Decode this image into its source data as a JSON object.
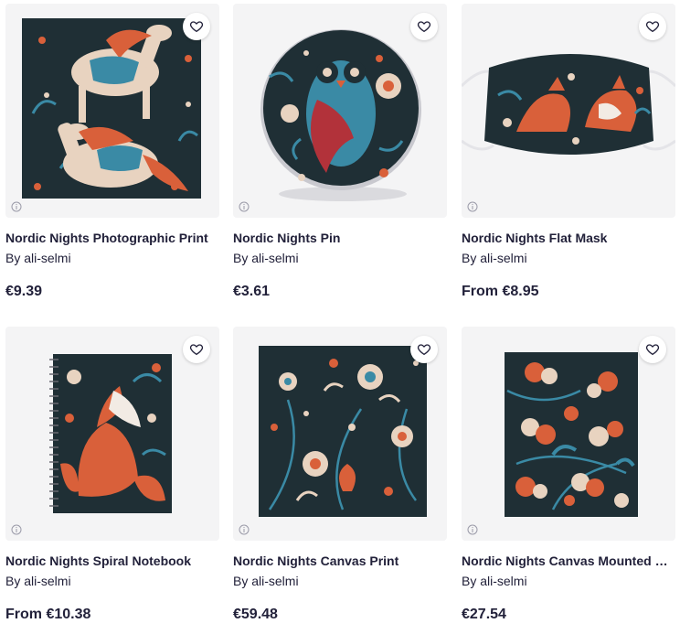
{
  "products": [
    {
      "title": "Nordic Nights Photographic Print",
      "by": "By ali-selmi",
      "price": "€9.39",
      "image": "horse-pattern-print"
    },
    {
      "title": "Nordic Nights Pin",
      "by": "By ali-selmi",
      "price": "€3.61",
      "image": "owl-pin"
    },
    {
      "title": "Nordic Nights Flat Mask",
      "by": "By ali-selmi",
      "price": "From €8.95",
      "image": "fox-flat-mask"
    },
    {
      "title": "Nordic Nights Spiral Notebook",
      "by": "By ali-selmi",
      "price": "From €10.38",
      "image": "fox-spiral-notebook"
    },
    {
      "title": "Nordic Nights Canvas Print",
      "by": "By ali-selmi",
      "price": "€59.48",
      "image": "floral-canvas-print"
    },
    {
      "title": "Nordic Nights Canvas Mounted Print",
      "by": "By ali-selmi",
      "price": "€27.54",
      "image": "berries-canvas-mounted-print"
    }
  ],
  "icons": {
    "favorite": "heart-outline-icon",
    "info": "info-icon"
  },
  "colors": {
    "text": "#22213a",
    "artwork_dark": "#1f2f35",
    "accent_orange": "#d9603a",
    "accent_teal": "#3a8aa5",
    "cream": "#e8d3c0"
  }
}
